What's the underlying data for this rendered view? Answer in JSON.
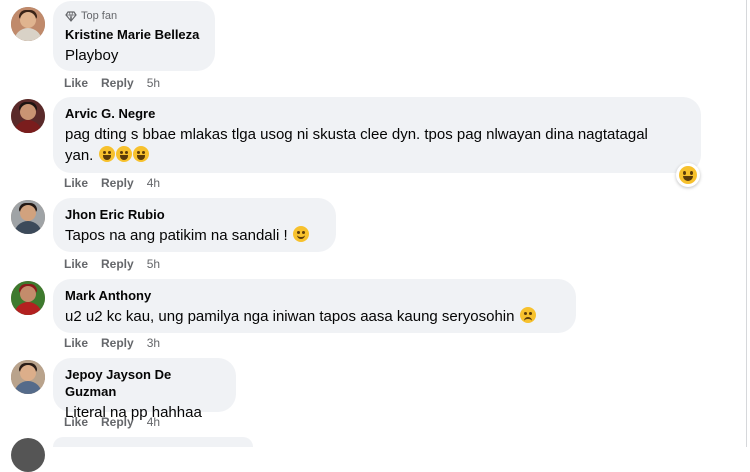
{
  "comments": [
    {
      "badge": "Top fan",
      "author": "Kristine Marie Belleza",
      "text": "Playboy",
      "like": "Like",
      "reply": "Reply",
      "time": "5h"
    },
    {
      "author": "Arvic G. Negre",
      "text_line1": "pag dting s bbae mlakas tlga usog ni skusta clee dyn. tpos pag nlwayan dina nagtatagal",
      "text_line2": "yan.",
      "like": "Like",
      "reply": "Reply",
      "time": "4h"
    },
    {
      "author": "Jhon Eric Rubio",
      "text": "Tapos na ang patikim na sandali !",
      "like": "Like",
      "reply": "Reply",
      "time": "5h"
    },
    {
      "author": "Mark Anthony",
      "text": "u2 u2 kc kau, ung pamilya nga iniwan tapos aasa kaung seryosohin",
      "like": "Like",
      "reply": "Reply",
      "time": "3h"
    },
    {
      "author": "Jepoy Jayson De Guzman",
      "text": "Literal na pp hahhaa",
      "like": "Like",
      "reply": "Reply",
      "time": "4h"
    }
  ],
  "icons": {
    "badge": "diamond-icon",
    "reaction": "haha-reaction-icon",
    "emoji_laugh": "rolling-laughing-emoji",
    "emoji_smile": "smiling-emoji",
    "emoji_pensive": "pensive-emoji"
  },
  "colors": {
    "bubble": "#f0f2f5",
    "secondary_text": "#65676b",
    "emoji": "#f7c12d"
  }
}
